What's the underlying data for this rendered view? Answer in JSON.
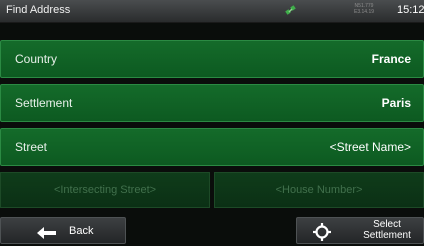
{
  "header": {
    "title": "Find Address",
    "coords_line1": "N51.779",
    "coords_line2": "E3.14.19",
    "clock": "15:12"
  },
  "rows": [
    {
      "label": "Country",
      "value": "France"
    },
    {
      "label": "Settlement",
      "value": "Paris"
    },
    {
      "label": "Street",
      "value": "<Street Name>"
    }
  ],
  "placeholders": {
    "intersecting": "<Intersecting Street>",
    "house_number": "<House Number>"
  },
  "footer": {
    "back_label": "Back",
    "select_label_line1": "Select",
    "select_label_line2": "Settlement"
  },
  "colors": {
    "row_green": "#146b2a",
    "disabled_green": "#0f3c1a",
    "bar_gray": "#3d4042"
  },
  "icons": {
    "gps": "satellite-icon",
    "back": "back-arrow-icon",
    "select": "crosshair-icon"
  }
}
